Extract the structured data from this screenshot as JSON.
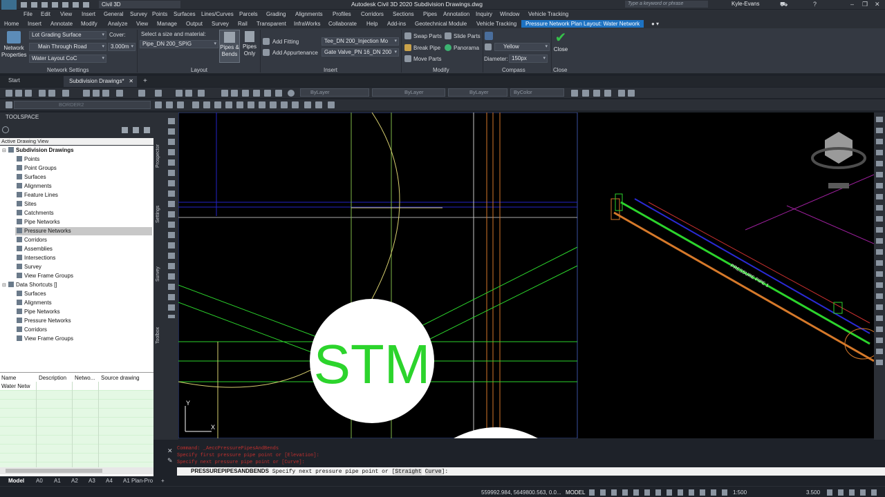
{
  "app": {
    "workspace": "Civil 3D",
    "title": "Autodesk Civil 3D 2020   Subdivision Drawings.dwg",
    "search_placeholder": "Type a keyword or phrase",
    "user": "Kyle-Evans",
    "logo": "C3D"
  },
  "menubar": [
    "File",
    "Edit",
    "View",
    "Insert",
    "General",
    "Survey",
    "Points",
    "Surfaces",
    "Lines/Curves",
    "Parcels",
    "Grading",
    "Alignments",
    "Profiles",
    "Corridors",
    "Sections",
    "Pipes",
    "Annotation",
    "Inquiry",
    "Window",
    "Vehicle Tracking"
  ],
  "ribbon_tabs": [
    "Home",
    "Insert",
    "Annotate",
    "Modify",
    "Analyze",
    "View",
    "Manage",
    "Output",
    "Survey",
    "Rail",
    "Transparent",
    "InfraWorks",
    "Collaborate",
    "Help",
    "Add-ins",
    "Geotechnical Module",
    "Vehicle Tracking",
    "Pressure Network Plan Layout: Water Network"
  ],
  "ribbon": {
    "network_properties": "Network Properties",
    "lot_grading_surface": "Lot Grading Surface",
    "main_through_road": "Main Through Road",
    "water_layout": "Water Layout CoC",
    "cover_label": "Cover:",
    "cover_value": "3.000m",
    "size_label": "Select a size and material:",
    "pipe_size": "Pipe_DN 200_SPIG",
    "pipes_bends": "Pipes & Bends",
    "pipes_only": "Pipes Only",
    "add_fitting": "Add Fitting",
    "add_appurtenance": "Add Appurtenance",
    "fitting_value": "Tee_DN 200_Injection Mo",
    "appurtenance_value": "Gate Valve_PN 16_DN 200",
    "swap_parts": "Swap Parts",
    "slide_parts": "Slide Parts",
    "break_pipe": "Break Pipe",
    "panorama": "Panorama",
    "move_parts": "Move Parts",
    "compass_color": "Yellow",
    "diameter_label": "Diameter:",
    "diameter_value": "150px",
    "close": "Close",
    "panels": [
      "Network Settings",
      "Layout",
      "Insert",
      "Modify",
      "Compass",
      "Close"
    ]
  },
  "file_tabs": {
    "start": "Start",
    "doc": "Subdivision Drawings*"
  },
  "toolbar": {
    "layer_combo": "ByLayer",
    "linetype_combo": "ByLayer",
    "lineweight_combo": "ByLayer",
    "color_combo": "ByColor",
    "layer_state": "BORDER2"
  },
  "toolspace": {
    "title": "TOOLSPACE",
    "view": "Active Drawing View",
    "root": "Subdivision Drawings",
    "items": [
      "Points",
      "Point Groups",
      "Surfaces",
      "Alignments",
      "Feature Lines",
      "Sites",
      "Catchments",
      "Pipe Networks",
      "Pressure Networks",
      "Corridors",
      "Assemblies",
      "Intersections",
      "Survey",
      "View Frame Groups"
    ],
    "shortcuts_root": "Data Shortcuts []",
    "shortcuts": [
      "Surfaces",
      "Alignments",
      "Pipe Networks",
      "Pressure Networks",
      "Corridors",
      "View Frame Groups"
    ],
    "table_headers": [
      "Name",
      "Description",
      "Netwo...",
      "Source drawing"
    ],
    "table_row": "Water Netw"
  },
  "side_tabs": [
    "Prospector",
    "Settings",
    "Survey",
    "Toolbox"
  ],
  "drawing": {
    "label": "STM",
    "pipe_label": "PRESSURE PIPE 1"
  },
  "command": {
    "history": [
      "Command: _AeccPressurePipesAndBends",
      "Specify first pressure pipe point or [Elevation]:",
      "Specify next pressure pipe point or [Curve]:"
    ],
    "cmd": "PRESSUREPIPESANDBENDS",
    "prompt": "Specify next pressure pipe point or [",
    "opt1": "Straight",
    "opt2": "Curve",
    "suffix": "]:"
  },
  "layout_tabs": [
    "Model",
    "A0",
    "A1",
    "A2",
    "A3",
    "A4",
    "A1 Plan-Pro"
  ],
  "status": {
    "coords": "559992.984, 5649800.563, 0.0...",
    "model": "MODEL",
    "scale": "1:500",
    "lineweight": "3.500"
  },
  "colors": {
    "accent": "#1d72c2",
    "pipe_green": "#2cd42c",
    "pipe_orange": "#d6792a",
    "pipe_blue": "#2a2ad6",
    "cmd_red": "#c0302e"
  }
}
